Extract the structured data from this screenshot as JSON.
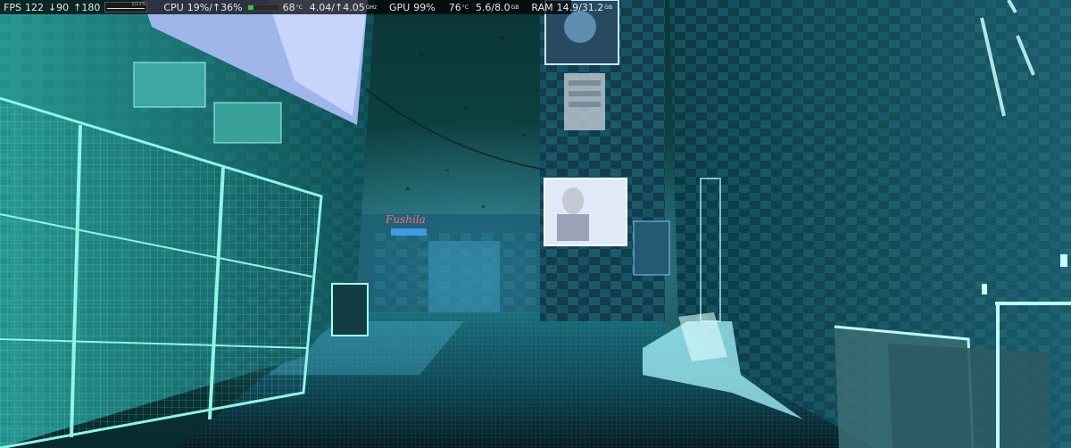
{
  "osd": {
    "fps": {
      "label": "FPS",
      "current": "122",
      "low_arrow": "↓",
      "low": "90",
      "high_arrow": "↑",
      "high": "180",
      "graph_caption": "1/11%"
    },
    "cpu": {
      "label": "CPU",
      "usage": "19%/↑36%",
      "temp": "68",
      "temp_unit": "°C",
      "clock": "4.04/↑4.05",
      "clock_unit": "GHz",
      "load_fraction": 0.19
    },
    "gpu": {
      "label": "GPU",
      "usage": "99%",
      "temp": "76",
      "temp_unit": "°C",
      "vram": "5.6/8.0",
      "vram_unit": "GB"
    },
    "ram": {
      "label": "RAM",
      "usage": "14.9/31.2",
      "unit": "GB"
    },
    "colors": {
      "cpu_bar": "#3fbf3f",
      "background": "#000000"
    }
  },
  "scene": {
    "description_colors": {
      "ambient": "#0e4a4a",
      "neon_cyan": "#7ff0e0",
      "hologram_blue": "#5aa8ff",
      "neon_red": "#ff5a6a"
    },
    "signage_text": "Fushila"
  }
}
